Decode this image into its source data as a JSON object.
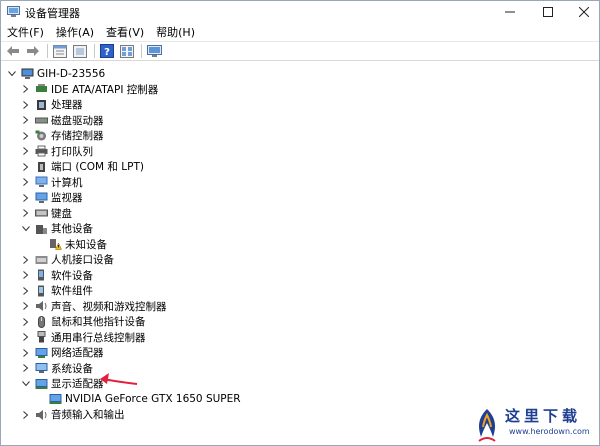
{
  "window": {
    "title": "设备管理器"
  },
  "menu": [
    "文件(F)",
    "操作(A)",
    "查看(V)",
    "帮助(H)"
  ],
  "toolbar": [
    "back-arrow-icon",
    "forward-arrow-icon",
    "properties-icon",
    "show-hidden-icon",
    "help-icon",
    "view-icon",
    "monitor-icon"
  ],
  "tree": {
    "root": "GIH-D-23556",
    "items": [
      {
        "label": "IDE ATA/ATAPI 控制器",
        "icon": "ide-controller-icon",
        "expanded": false
      },
      {
        "label": "处理器",
        "icon": "cpu-icon",
        "expanded": false
      },
      {
        "label": "磁盘驱动器",
        "icon": "disk-drive-icon",
        "expanded": false
      },
      {
        "label": "存储控制器",
        "icon": "storage-controller-icon",
        "expanded": false
      },
      {
        "label": "打印队列",
        "icon": "printer-icon",
        "expanded": false
      },
      {
        "label": "端口 (COM 和 LPT)",
        "icon": "port-icon",
        "expanded": false
      },
      {
        "label": "计算机",
        "icon": "computer-icon",
        "expanded": false
      },
      {
        "label": "监视器",
        "icon": "monitor-icon",
        "expanded": false
      },
      {
        "label": "键盘",
        "icon": "keyboard-icon",
        "expanded": false
      },
      {
        "label": "其他设备",
        "icon": "other-devices-icon",
        "expanded": true,
        "children": [
          {
            "label": "未知设备",
            "icon": "unknown-device-warning-icon"
          }
        ]
      },
      {
        "label": "人机接口设备",
        "icon": "hid-icon",
        "expanded": false
      },
      {
        "label": "软件设备",
        "icon": "software-device-icon",
        "expanded": false
      },
      {
        "label": "软件组件",
        "icon": "software-component-icon",
        "expanded": false
      },
      {
        "label": "声音、视频和游戏控制器",
        "icon": "sound-icon",
        "expanded": false
      },
      {
        "label": "鼠标和其他指针设备",
        "icon": "mouse-icon",
        "expanded": false
      },
      {
        "label": "通用串行总线控制器",
        "icon": "usb-icon",
        "expanded": false
      },
      {
        "label": "网络适配器",
        "icon": "network-adapter-icon",
        "expanded": false
      },
      {
        "label": "系统设备",
        "icon": "system-device-icon",
        "expanded": false
      },
      {
        "label": "显示适配器",
        "icon": "display-adapter-icon",
        "expanded": true,
        "children": [
          {
            "label": "NVIDIA GeForce GTX 1650 SUPER",
            "icon": "gpu-icon"
          }
        ]
      },
      {
        "label": "音频输入和输出",
        "icon": "audio-io-icon",
        "expanded": false
      }
    ]
  },
  "annotation": {
    "color": "#e0233b"
  },
  "watermark": {
    "title": "这里下载",
    "url": "www.herodown.com",
    "color": "#1f3f93"
  }
}
